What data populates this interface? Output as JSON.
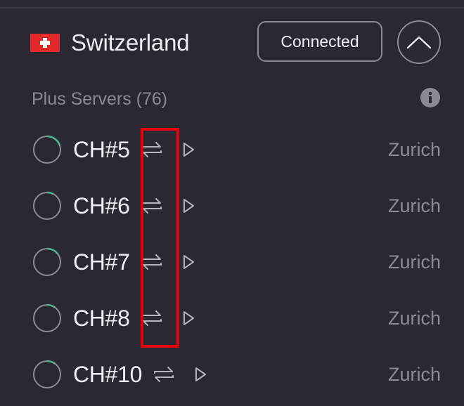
{
  "header": {
    "country": "Switzerland",
    "flag_icon": "switzerland-flag-icon",
    "status_label": "Connected",
    "collapse_icon": "chevron-up-icon"
  },
  "section": {
    "title": "Plus Servers (76)",
    "info_icon": "info-icon"
  },
  "servers": [
    {
      "name": "CH#5",
      "city": "Zurich",
      "load_fraction": 0.2
    },
    {
      "name": "CH#6",
      "city": "Zurich",
      "load_fraction": 0.08
    },
    {
      "name": "CH#7",
      "city": "Zurich",
      "load_fraction": 0.15
    },
    {
      "name": "CH#8",
      "city": "Zurich",
      "load_fraction": 0.1
    },
    {
      "name": "CH#10",
      "city": "Zurich",
      "load_fraction": 0.1
    }
  ],
  "colors": {
    "background": "#292833",
    "load_accent": "#4fb48d",
    "highlight": "#e8000b",
    "flag_red": "#e22a2a"
  },
  "icons": {
    "feature": "p2p-arrows-icon",
    "connect": "play-icon",
    "load": "server-load-icon"
  }
}
